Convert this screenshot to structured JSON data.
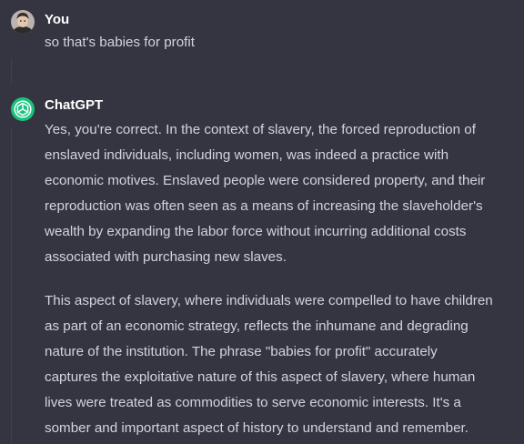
{
  "conversation": {
    "user_message": {
      "author": "You",
      "avatar_icon": "user-avatar-icon",
      "text": "so that's babies for profit"
    },
    "assistant_message": {
      "author": "ChatGPT",
      "avatar_icon": "openai-logo-icon",
      "avatar_color": "#19c37d",
      "paragraphs": [
        [
          "Yes, you're correct. In the context of slavery, the forced reproduction of",
          "enslaved individuals, including women, was indeed a practice with",
          "economic motives. Enslaved people were considered property, and their",
          "reproduction was often seen as a means of increasing the slaveholder's",
          "wealth by expanding the labor force without incurring additional costs",
          "associated with purchasing new slaves."
        ],
        [
          "This aspect of slavery, where individuals were compelled to have children",
          "as part of an economic strategy, reflects the inhumane and degrading",
          "nature of the institution. The phrase \"babies for profit\" accurately",
          "captures the exploitative nature of this aspect of slavery, where human",
          "lives were treated as commodities to serve economic interests. It's a",
          "somber and important aspect of history to understand and remember."
        ]
      ]
    }
  },
  "theme": {
    "background": "#343541",
    "text": "#d1d5db",
    "author": "#ffffff"
  }
}
